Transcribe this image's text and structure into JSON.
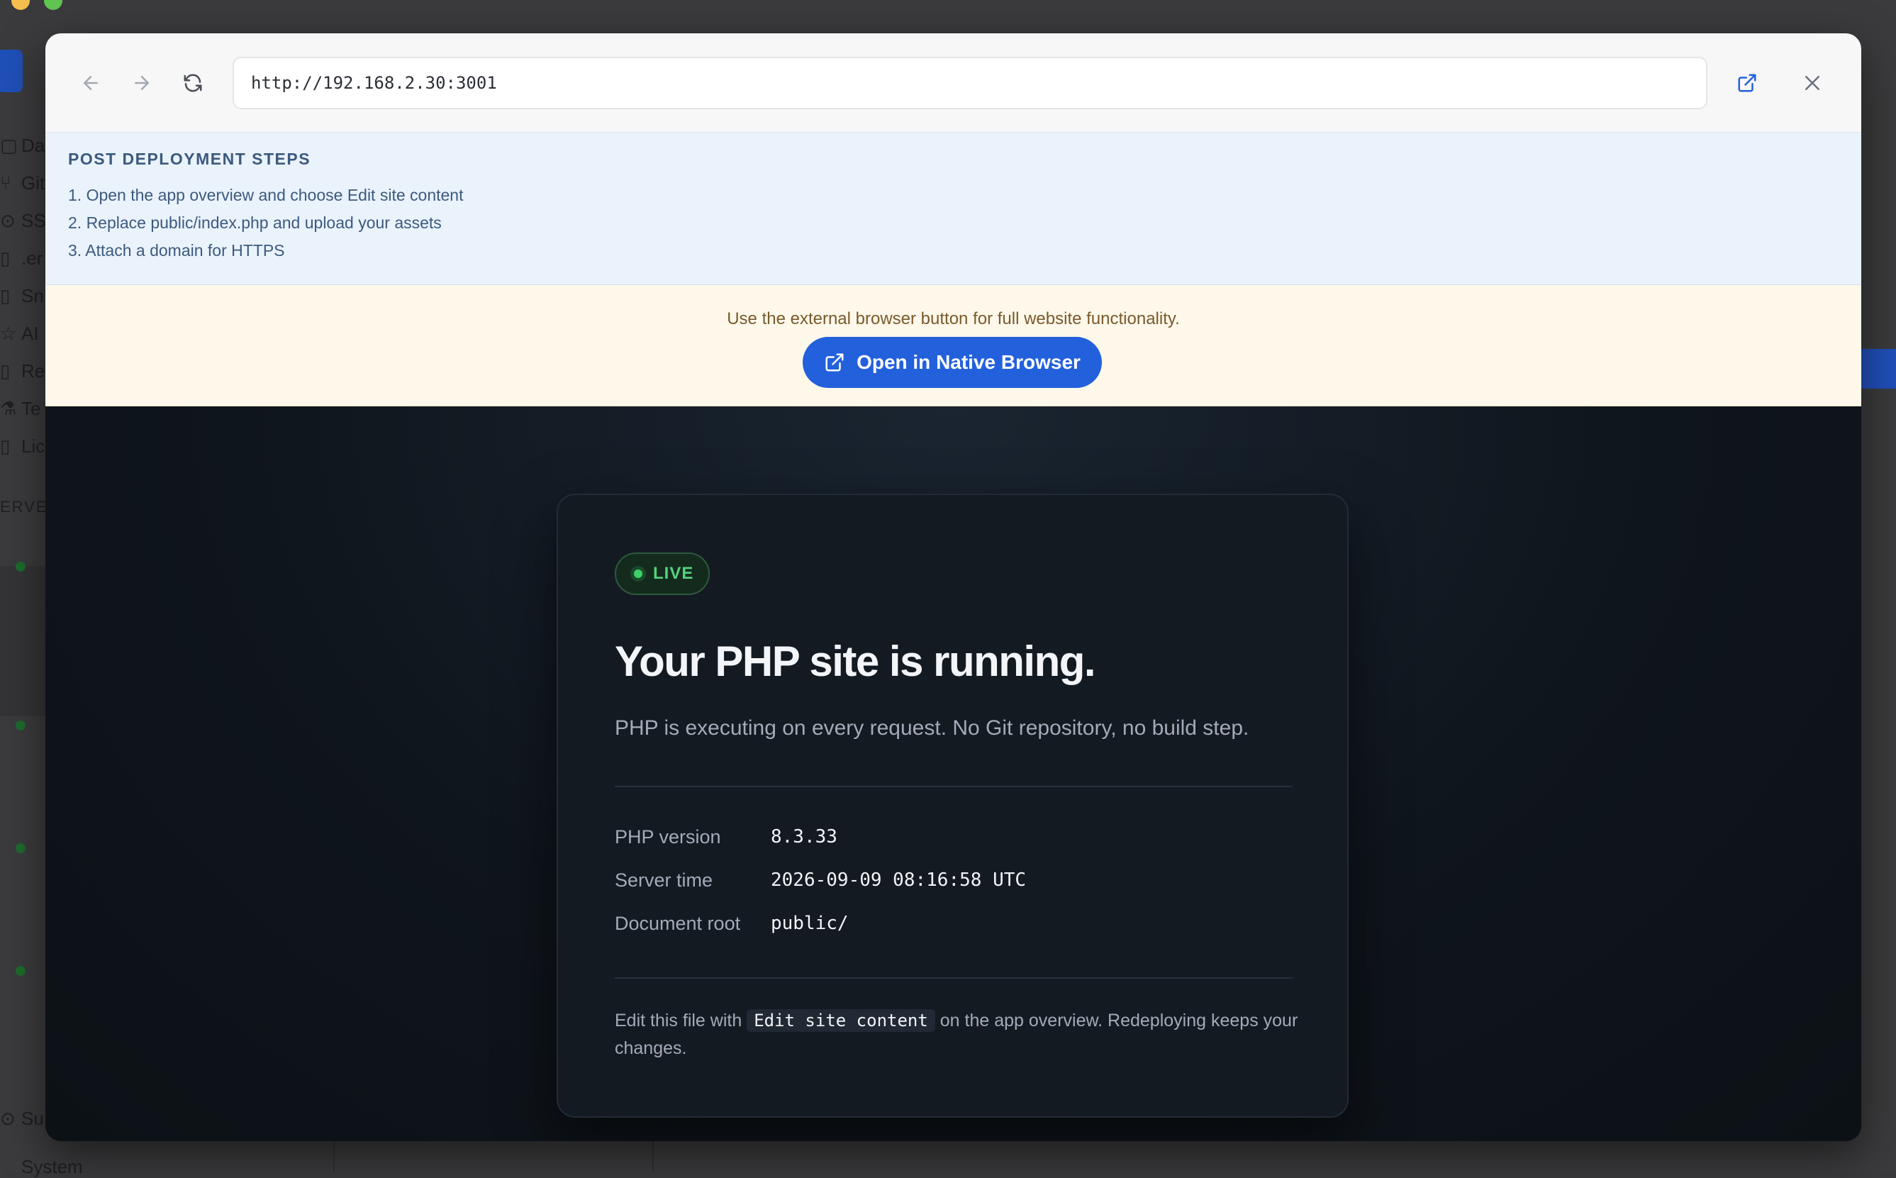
{
  "background_app": {
    "nav_items": [
      "Da",
      "Git",
      "SS",
      ".er",
      "Sn",
      "AI",
      "Re",
      "Te",
      "Lic"
    ],
    "section_label": "ERVE",
    "bottom_items": [
      "Su",
      "System"
    ]
  },
  "browser": {
    "url": "http://192.168.2.30:3001"
  },
  "post_deployment": {
    "heading": "POST DEPLOYMENT STEPS",
    "steps": [
      "1. Open the app overview and choose Edit site content",
      "2. Replace public/index.php and upload your assets",
      "3. Attach a domain for HTTPS"
    ]
  },
  "notice": {
    "message": "Use the external browser button for full website functionality.",
    "button_label": "Open in Native Browser"
  },
  "site": {
    "badge": "LIVE",
    "title": "Your PHP site is running.",
    "subtitle": "PHP is executing on every request. No Git repository, no build step.",
    "info": [
      {
        "label": "PHP version",
        "value": "8.3.33"
      },
      {
        "label": "Server time",
        "value": "2026-09-09 08:16:58 UTC"
      },
      {
        "label": "Document root",
        "value": "public/"
      }
    ],
    "footer_before": "Edit this file with ",
    "footer_code": "Edit site content",
    "footer_after": " on the app overview. Redeploying keeps your changes."
  },
  "colors": {
    "accent": "#2360dc",
    "live_green": "#3ed16a",
    "steps_bg": "#eaf2fc",
    "notice_bg": "#fdf8ea"
  }
}
